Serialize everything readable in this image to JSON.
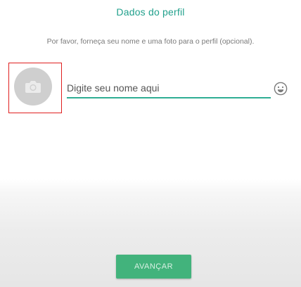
{
  "header": {
    "title": "Dados do perfil"
  },
  "intro": {
    "text": "Por favor, forneça seu nome e uma foto para o perfil (opcional)."
  },
  "profile": {
    "photo_icon": "camera-icon",
    "name_placeholder": "Digite seu nome aqui",
    "name_value": "",
    "emoji_icon": "smiley-icon"
  },
  "footer": {
    "next_label": "AVANÇAR"
  },
  "colors": {
    "accent": "#21a08c",
    "underline": "#2fae94",
    "button": "#42b37c",
    "highlight_box": "#e02020"
  }
}
